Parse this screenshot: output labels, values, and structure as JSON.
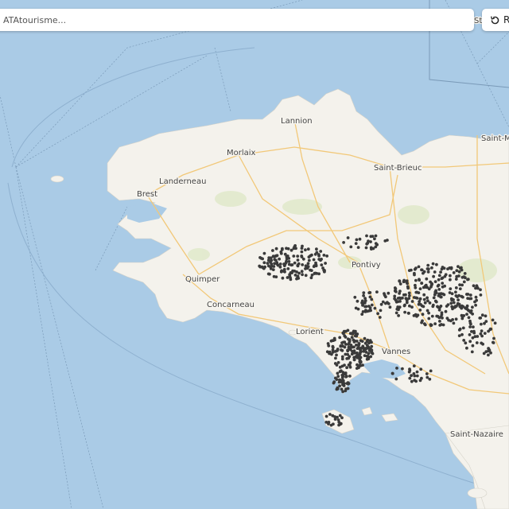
{
  "search": {
    "placeholder": "ATAtourisme..."
  },
  "reset_button": {
    "label": "R",
    "icon": "reset-icon"
  },
  "cities": [
    {
      "name": "Lannion"
    },
    {
      "name": "Morlaix"
    },
    {
      "name": "Saint-Brieuc"
    },
    {
      "name": "Landerneau"
    },
    {
      "name": "Brest"
    },
    {
      "name": "Pontivy"
    },
    {
      "name": "Quimper"
    },
    {
      "name": "Concarneau"
    },
    {
      "name": "Lorient"
    },
    {
      "name": "Vannes"
    },
    {
      "name": "Saint-Nazaire"
    },
    {
      "name": "Saint-M"
    },
    {
      "name": "St"
    }
  ],
  "colors": {
    "sea": "#aacbe6",
    "land": "#f4f2ec",
    "roads": "#f2c878",
    "markers": "#3a3a3a"
  }
}
